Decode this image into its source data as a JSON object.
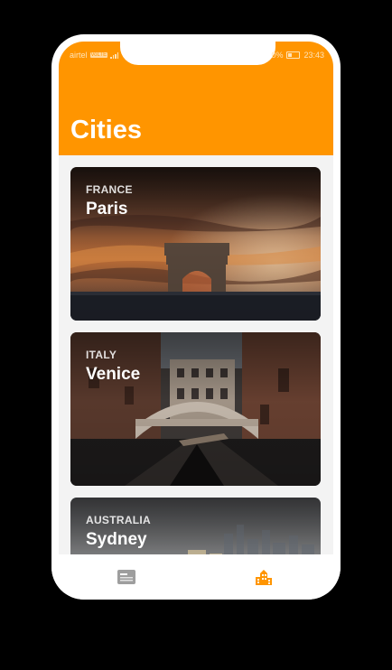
{
  "status_bar": {
    "carrier": "airtel",
    "network_badge": "VoLTE",
    "battery_percent": "0%",
    "time": "23:43"
  },
  "app_bar": {
    "title": "Cities",
    "color": "#ff9500"
  },
  "cities": [
    {
      "country": "FRANCE",
      "name": "Paris"
    },
    {
      "country": "ITALY",
      "name": "Venice"
    },
    {
      "country": "AUSTRALIA",
      "name": "Sydney"
    }
  ],
  "bottom_nav": {
    "items": [
      {
        "icon": "article-icon",
        "active": false,
        "color": "#9e9e9e"
      },
      {
        "icon": "city-icon",
        "active": true,
        "color": "#ff9500"
      }
    ]
  }
}
